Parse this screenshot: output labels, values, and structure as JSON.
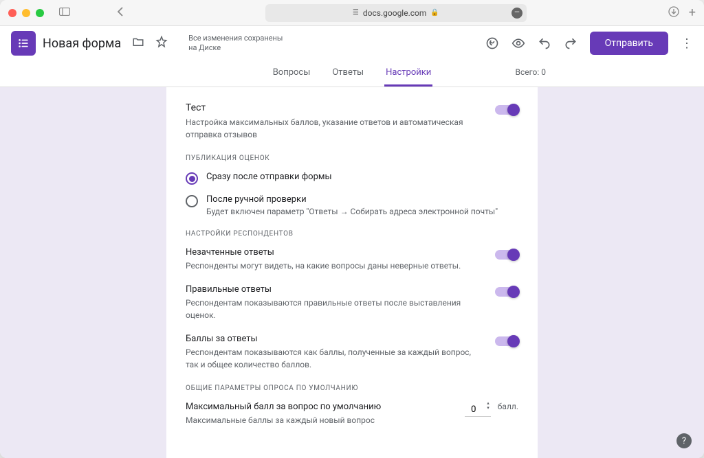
{
  "browser": {
    "url": "docs.google.com"
  },
  "header": {
    "title": "Новая форма",
    "saved_msg": "Все изменения сохранены на Диске",
    "send": "Отправить"
  },
  "tabs": {
    "questions": "Вопросы",
    "answers": "Ответы",
    "settings": "Настройки",
    "total": "Всего: 0"
  },
  "quiz": {
    "title": "Тест",
    "desc": "Настройка максимальных баллов, указание ответов и автоматическая отправка отзывов"
  },
  "publish": {
    "header": "ПУБЛИКАЦИЯ ОЦЕНОК",
    "opt1": "Сразу после отправки формы",
    "opt2": "После ручной проверки",
    "opt2_desc": "Будет включен параметр \"Ответы → Собирать адреса электронной почты\""
  },
  "respondent": {
    "header": "НАСТРОЙКИ РЕСПОНДЕНТОВ",
    "r1_title": "Незачтенные ответы",
    "r1_desc": "Респонденты могут видеть, на какие вопросы даны неверные ответы.",
    "r2_title": "Правильные ответы",
    "r2_desc": "Респондентам показываются правильные ответы после выставления оценок.",
    "r3_title": "Баллы за ответы",
    "r3_desc": "Респондентам показываются как баллы, полученные за каждый вопрос, так и общее количество баллов."
  },
  "defaults": {
    "header": "ОБЩИЕ ПАРАМЕТРЫ ОПРОСА ПО УМОЛЧАНИЮ",
    "d1_title": "Максимальный балл за вопрос по умолчанию",
    "d1_desc": "Максимальные баллы за каждый новый вопрос",
    "value": "0",
    "unit": "балл."
  }
}
